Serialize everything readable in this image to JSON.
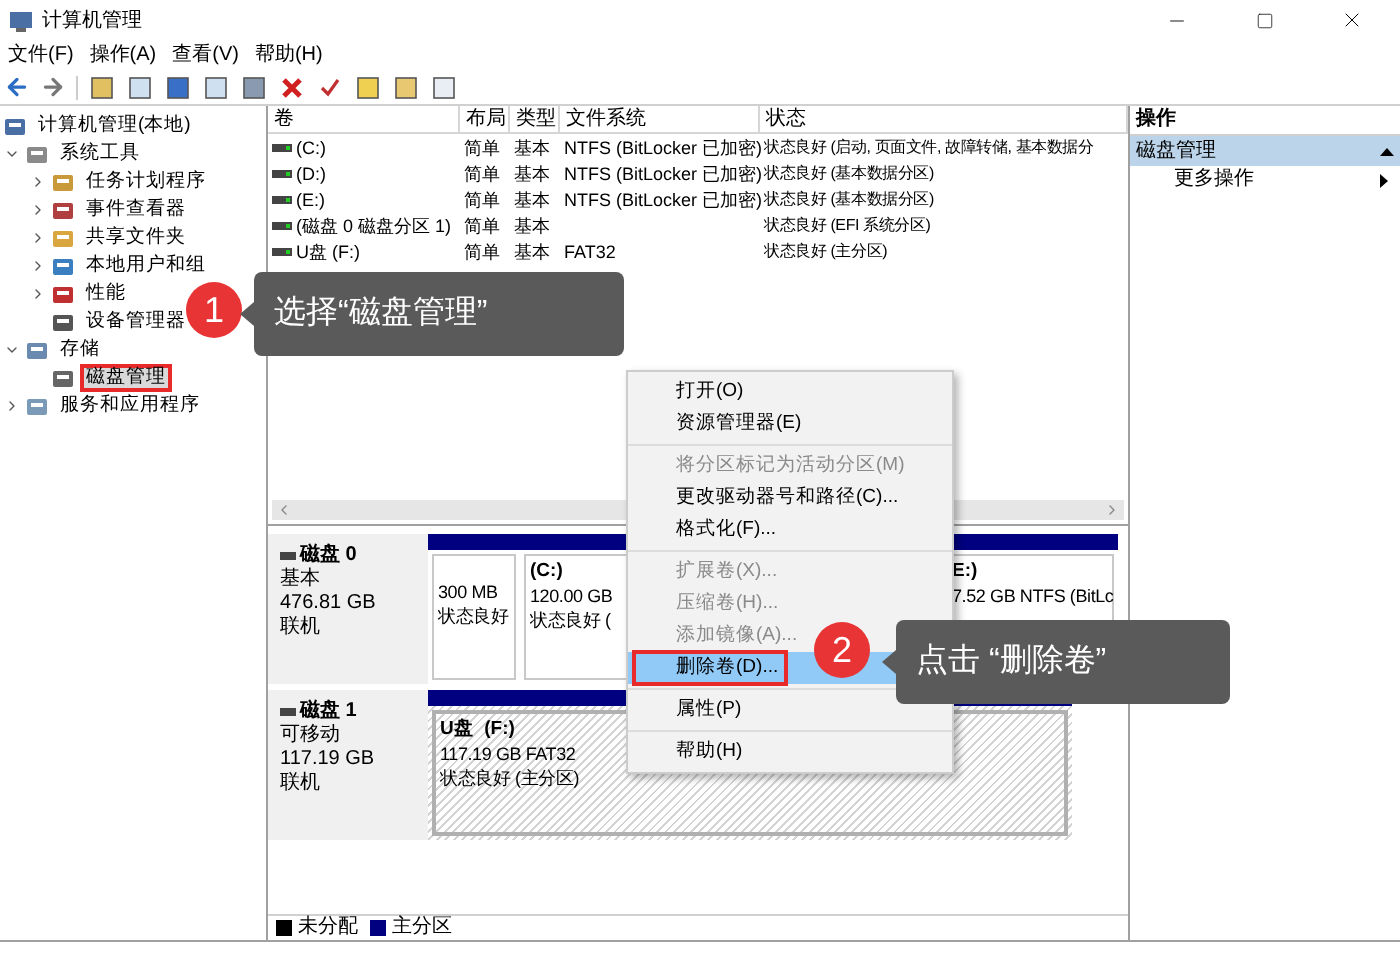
{
  "window": {
    "title": "计算机管理"
  },
  "menu": [
    "文件(F)",
    "操作(A)",
    "查看(V)",
    "帮助(H)"
  ],
  "tree": [
    {
      "label": "计算机管理(本地)",
      "selected": false,
      "children": [
        {
          "label": "系统工具",
          "selected": false,
          "expanded": true,
          "children": [
            {
              "label": "任务计划程序",
              "selected": false,
              "expanded": false
            },
            {
              "label": "事件查看器",
              "selected": false,
              "expanded": false
            },
            {
              "label": "共享文件夹",
              "selected": false,
              "expanded": false
            },
            {
              "label": "本地用户和组",
              "selected": false,
              "expanded": false
            },
            {
              "label": "性能",
              "selected": false,
              "expanded": false
            },
            {
              "label": "设备管理器",
              "selected": false
            }
          ]
        },
        {
          "label": "存储",
          "selected": false,
          "expanded": true,
          "children": [
            {
              "label": "磁盘管理",
              "selected": true,
              "outlined": true
            }
          ]
        },
        {
          "label": "服务和应用程序",
          "selected": false,
          "expanded": false
        }
      ]
    }
  ],
  "volumes": {
    "columns": [
      "卷",
      "布局",
      "类型",
      "文件系统",
      "状态"
    ],
    "rows": [
      [
        "(C:)",
        "简单",
        "基本",
        "NTFS (BitLocker 已加密)",
        "状态良好 (启动, 页面文件, 故障转储, 基本数据分"
      ],
      [
        "(D:)",
        "简单",
        "基本",
        "NTFS (BitLocker 已加密)",
        "状态良好 (基本数据分区)"
      ],
      [
        "(E:)",
        "简单",
        "基本",
        "NTFS (BitLocker 已加密)",
        "状态良好 (基本数据分区)"
      ],
      [
        "(磁盘 0 磁盘分区 1)",
        "简单",
        "基本",
        "",
        "状态良好 (EFI 系统分区)"
      ],
      [
        "U盘 (F:)",
        "简单",
        "基本",
        "FAT32",
        "状态良好 (主分区)"
      ]
    ]
  },
  "disks": [
    {
      "name": "磁盘 0",
      "type": "基本",
      "size": "476.81 GB",
      "status": "联机",
      "partitions": [
        {
          "lines": [
            "300 MB",
            "状态良好"
          ],
          "selected": false
        },
        {
          "name": "(C:)",
          "lines": [
            "120.00 GB",
            "状态良好 ("
          ],
          "selected": false
        },
        {
          "name": "E:)",
          "lines": [
            "7.52 GB NTFS (BitLc"
          ],
          "selected": false
        }
      ]
    },
    {
      "name": "磁盘 1",
      "type": "可移动",
      "size": "117.19 GB",
      "status": "联机",
      "partitions": [
        {
          "name": "U盘  (F:)",
          "lines": [
            "117.19 GB FAT32",
            "状态良好 (主分区)"
          ],
          "selected": true
        }
      ]
    }
  ],
  "legend": [
    {
      "label": "未分配",
      "color": "#000000"
    },
    {
      "label": "主分区",
      "color": "#000080"
    }
  ],
  "actions": {
    "title": "操作",
    "section": "磁盘管理",
    "items": [
      "更多操作"
    ]
  },
  "context_menu": [
    [
      {
        "label": "打开(O)",
        "disabled": false,
        "selected": false
      },
      {
        "label": "资源管理器(E)",
        "disabled": false,
        "selected": false
      }
    ],
    [
      {
        "label": "将分区标记为活动分区(M)",
        "disabled": true,
        "selected": false
      },
      {
        "label": "更改驱动器号和路径(C)...",
        "disabled": false,
        "selected": false
      },
      {
        "label": "格式化(F)...",
        "disabled": false,
        "selected": false
      }
    ],
    [
      {
        "label": "扩展卷(X)...",
        "disabled": true,
        "selected": false
      },
      {
        "label": "压缩卷(H)...",
        "disabled": true,
        "selected": false
      },
      {
        "label": "添加镜像(A)...",
        "disabled": true,
        "selected": false
      },
      {
        "label": "删除卷(D)...",
        "disabled": false,
        "selected": true,
        "outlined": true
      }
    ],
    [
      {
        "label": "属性(P)",
        "disabled": false,
        "selected": false
      }
    ],
    [
      {
        "label": "帮助(H)",
        "disabled": false,
        "selected": false
      }
    ]
  ],
  "callouts": [
    {
      "number": "1",
      "text": "选择“磁盘管理”"
    },
    {
      "number": "2",
      "text": "点击 “删除卷”"
    }
  ]
}
